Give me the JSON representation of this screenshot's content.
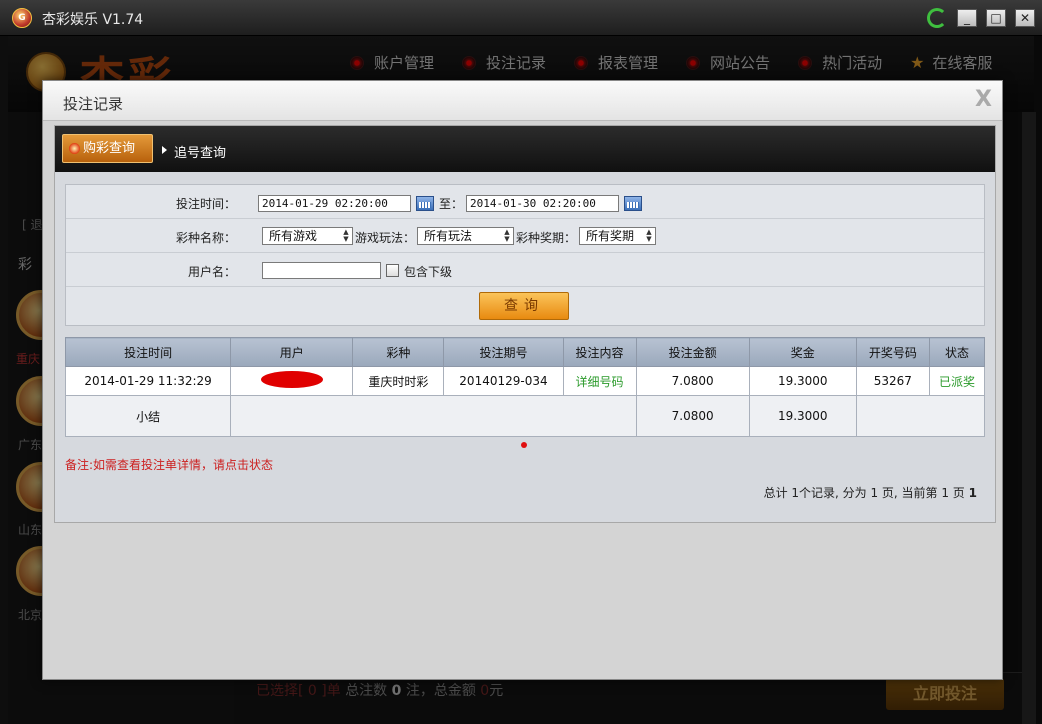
{
  "app": {
    "title": "杏彩娱乐 V1.74",
    "logo_text": "G",
    "brand": "杏彩"
  },
  "window_controls": {
    "minimize": "_",
    "maximize": "□",
    "close": "✕"
  },
  "nav": [
    {
      "label": "账户管理",
      "icon": "record-dot-icon"
    },
    {
      "label": "投注记录",
      "icon": "record-dot-icon"
    },
    {
      "label": "报表管理",
      "icon": "record-dot-icon"
    },
    {
      "label": "网站公告",
      "icon": "record-dot-icon"
    },
    {
      "label": "热门活动",
      "icon": "record-dot-icon"
    },
    {
      "label": "在线客服",
      "icon": "star-icon"
    }
  ],
  "background": {
    "left_labels": [
      "[ 退",
      "彩",
      "重庆",
      "广东",
      "山东",
      "北京"
    ],
    "bottom_selected": "已选择[ 0 ]单",
    "bottom_count_prefix": "总注数",
    "bottom_count": "0",
    "bottom_count_suffix": "注，总金额",
    "bottom_amount": "0",
    "bottom_amount_unit": "元",
    "submit_label": "立即投注"
  },
  "dialog": {
    "title": "投注记录",
    "close": "X",
    "tabs": {
      "active": "购彩查询",
      "inactive": "追号查询"
    },
    "form": {
      "time_label": "投注时间：",
      "time_from": "2014-01-29 02:20:00",
      "time_sep": "至：",
      "time_to": "2014-01-30 02:20:00",
      "lottery_label": "彩种名称：",
      "lottery_value": "所有游戏",
      "play_label": "游戏玩法：",
      "play_value": "所有玩法",
      "period_label": "彩种奖期：",
      "period_value": "所有奖期",
      "user_label": "用户名：",
      "user_value": "",
      "include_sub_label": "包含下级",
      "query_button": "查询"
    },
    "table": {
      "headers": [
        "投注时间",
        "用户",
        "彩种",
        "投注期号",
        "投注内容",
        "投注金额",
        "奖金",
        "开奖号码",
        "状态"
      ],
      "rows": [
        {
          "time": "2014-01-29 11:32:29",
          "user": "",
          "lottery": "重庆时时彩",
          "period": "20140129-034",
          "content": "详细号码",
          "amount": "7.0800",
          "prize": "19.3000",
          "draw": "53267",
          "status": "已派奖"
        }
      ],
      "summary": {
        "label": "小结",
        "amount": "7.0800",
        "prize": "19.3000"
      }
    },
    "note": "备注:如需查看投注单详情，请点击状态",
    "pager": {
      "prefix": "总计 1个记录, 分为 1 页, 当前第 1 页",
      "current": "1"
    }
  },
  "colors": {
    "accent_orange": "#e88a10",
    "status_green": "#2a9a2a",
    "note_red": "#cc1f1f"
  }
}
